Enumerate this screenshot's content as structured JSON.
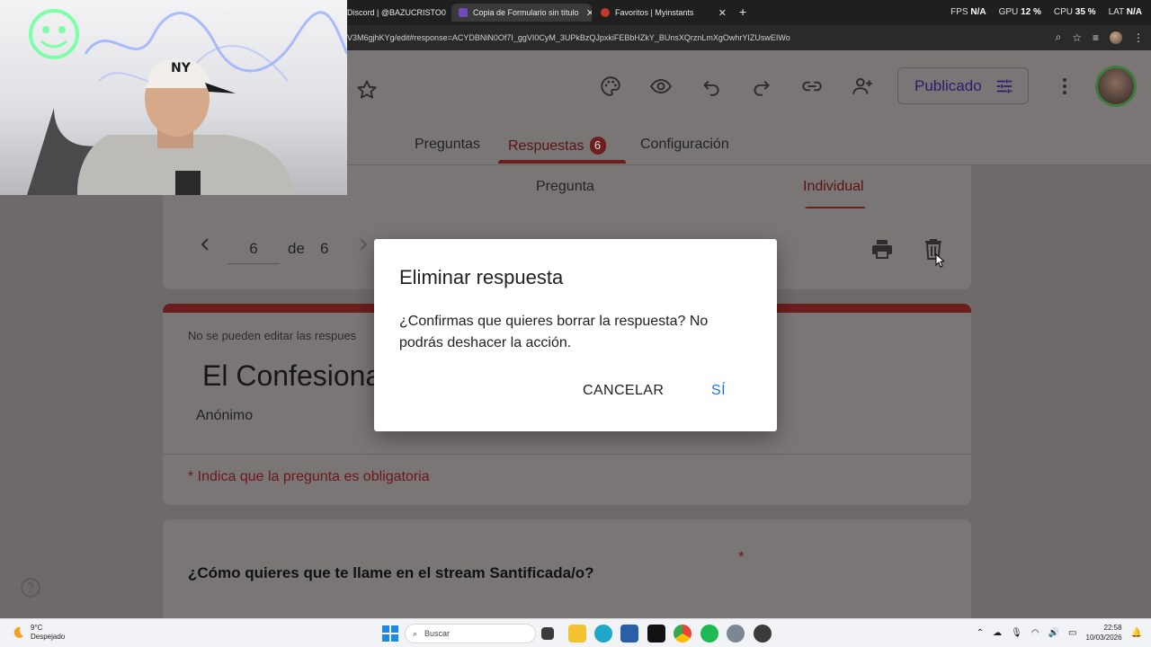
{
  "browser": {
    "tabs": [
      {
        "label": "Discord | @BAZUCRISTO0",
        "favicon_color": "#5865f2"
      },
      {
        "label": "Copia de Formulario sin título",
        "favicon_color": "#7248b9"
      },
      {
        "label": "Favoritos | Myinstants",
        "favicon_color": "#c0392b"
      }
    ],
    "url": "V3M6gjhKYg/edit#response=ACYDBNiN0Of7I_ggVI0CyM_3UPkBzQJpxkiFEBbHZkY_BUnsXQrznLmXgOwhrYIZUswEIWo",
    "perf": {
      "fps_label": "FPS",
      "fps": "N/A",
      "gpu_label": "GPU",
      "gpu": "12 %",
      "cpu_label": "CPU",
      "cpu": "35 %",
      "lat_label": "LAT",
      "lat": "N/A"
    }
  },
  "header": {
    "publish_label": "Publicado",
    "tabs": {
      "questions": "Preguntas",
      "responses": "Respuestas",
      "responses_count": "6",
      "settings": "Configuración"
    }
  },
  "subtabs": {
    "question": "Pregunta",
    "individual": "Individual"
  },
  "navigator": {
    "current": "6",
    "of_label": "de",
    "total": "6"
  },
  "form": {
    "edit_note": "No se pueden editar las respues",
    "title": "El Confesiona",
    "anonymous": "Anónimo",
    "required_note": "* Indica que la pregunta es obligatoria",
    "question1": "¿Cómo quieres que te llame en el stream Santificada/o?",
    "required_star": "*"
  },
  "dialog": {
    "title": "Eliminar respuesta",
    "body": "¿Confirmas que quieres borrar la respuesta? No podrás deshacer la acción.",
    "cancel": "CANCELAR",
    "confirm": "SÍ"
  },
  "taskbar": {
    "weather_temp": "9°C",
    "weather_desc": "Despejado",
    "search_placeholder": "Buscar",
    "time": "22:58",
    "date": "10/03/2026"
  },
  "colors": {
    "accent": "#6b1f1f",
    "confirm_blue": "#1a73e8",
    "publish_text": "#2c1b6e"
  }
}
